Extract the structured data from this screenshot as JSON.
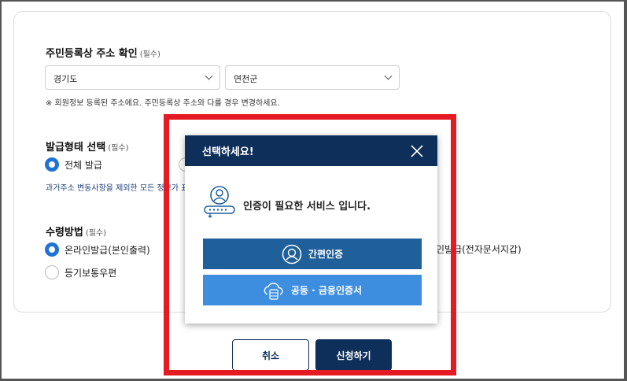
{
  "form": {
    "address": {
      "title": "주민등록상 주소 확인",
      "required": "(필수)",
      "province_value": "경기도",
      "city_value": "연천군",
      "note": "※ 회원정보 등록된 주소에요. 주민등록상 주소와 다를 경우 변경하세요."
    },
    "issue_type": {
      "title": "발급형태 선택",
      "required": "(필수)",
      "option_full": "전체 발급",
      "description": "과거주소 변동사항을 제외한 모든 정보가 표"
    },
    "receive": {
      "title": "수령방법",
      "required": "(필수)",
      "option_online": "온라인발급(본인출력)",
      "option_mail": "등기보통우편",
      "option_partial": "인발급(전자문서지갑)"
    },
    "buttons": {
      "cancel": "취소",
      "apply": "신청하기"
    }
  },
  "modal": {
    "title": "선택하세요!",
    "message": "인증이 필요한 서비스 입니다.",
    "simple_auth": "간편인증",
    "cert_auth": "공동 · 금융인증서"
  },
  "colors": {
    "navy": "#0e2f5a",
    "blue_primary": "#1f5f9a",
    "blue_light": "#3e8ee0",
    "radio_accent": "#1f73d6",
    "highlight_red": "#e41b23"
  },
  "icons": [
    "chevron-down-icon",
    "close-icon",
    "auth-user-icon",
    "user-circle-icon",
    "cloud-server-icon"
  ]
}
